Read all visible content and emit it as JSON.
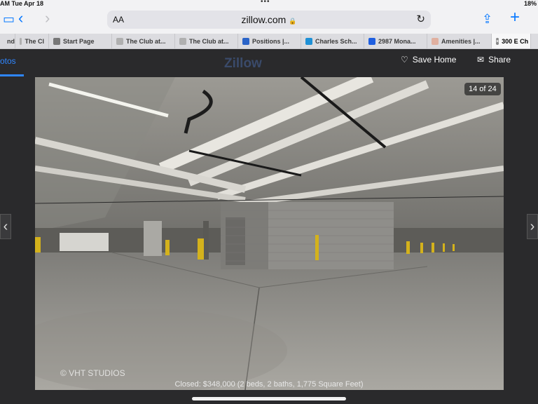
{
  "status_bar": {
    "time": "AM   Tue Apr 18",
    "right": "18%"
  },
  "toolbar": {
    "back_glyph": "‹",
    "forward_glyph": "›",
    "text_size": "AA",
    "domain": "zillow.com",
    "lock_glyph": "🔒",
    "reload_glyph": "↻",
    "share_glyph": "⇪",
    "new_tab_glyph": "+"
  },
  "tabs": [
    {
      "label": "nd",
      "icon": "tab-partial",
      "color": "#aaaaaa"
    },
    {
      "label": "The Cl",
      "icon": "m-favicon",
      "color": "#b0b0b0"
    },
    {
      "label": "Start Page",
      "icon": "star-favicon",
      "color": "#777777"
    },
    {
      "label": "The Club at...",
      "icon": "m-favicon",
      "color": "#b0b0b0"
    },
    {
      "label": "The Club at...",
      "icon": "m-favicon",
      "color": "#b0b0b0"
    },
    {
      "label": "Positions |...",
      "icon": "grid-favicon",
      "color": "#2a64c8"
    },
    {
      "label": "Charles Sch...",
      "icon": "schwab-favicon",
      "color": "#1e90d6"
    },
    {
      "label": "2987 Mona...",
      "icon": "zillow-favicon",
      "color": "#1f5fe0"
    },
    {
      "label": "Amenities |...",
      "icon": "amenities-favicon",
      "color": "#e0b0a0"
    },
    {
      "label": "300 E Ch",
      "icon": "close-icon",
      "color": "#888888",
      "active": true
    }
  ],
  "page": {
    "photos_tab": "otos",
    "logo": "Zillow",
    "save_home": "Save Home",
    "share": "Share",
    "counter": "14 of 24",
    "watermark": "© VHT STUDIOS",
    "caption": "Closed: $348,000 (2 beds, 2 baths, 1,775 Square Feet)",
    "prev_glyph": "‹",
    "next_glyph": "›"
  },
  "colors": {
    "accent": "#0a7aff",
    "zillow_blue": "#2f86ff",
    "overlay": "#232323"
  }
}
